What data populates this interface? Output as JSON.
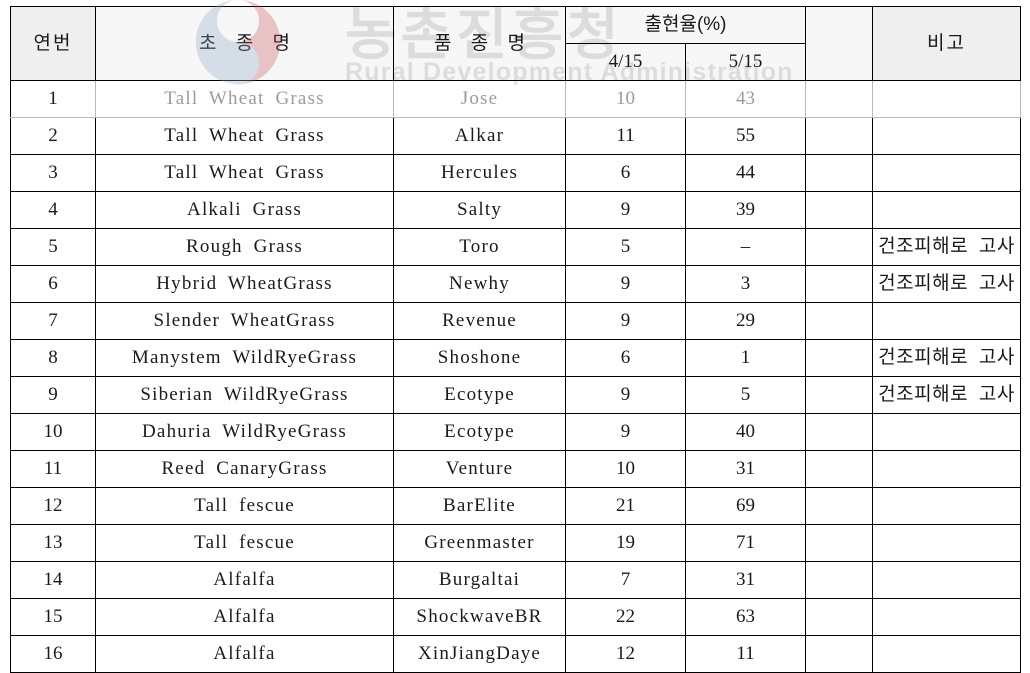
{
  "watermark": {
    "hangul": "농촌진흥청",
    "roman": "Rural Development Administration",
    "emblem": "taeguk-emblem",
    "colors": {
      "red": "#c94b55",
      "blue": "#5b7fa6"
    }
  },
  "table": {
    "headers": {
      "no": "연번",
      "species": "초 종 명",
      "variety": "품 종 명",
      "emergence_group": "출현율(%)",
      "date1": "4/15",
      "date2": "5/15",
      "spacer": "",
      "remark": "비고"
    },
    "rows": [
      {
        "no": "1",
        "species": "Tall Wheat Grass",
        "variety": "Jose",
        "d1": "10",
        "d2": "43",
        "remark": ""
      },
      {
        "no": "2",
        "species": "Tall Wheat Grass",
        "variety": "Alkar",
        "d1": "11",
        "d2": "55",
        "remark": ""
      },
      {
        "no": "3",
        "species": "Tall Wheat Grass",
        "variety": "Hercules",
        "d1": "6",
        "d2": "44",
        "remark": ""
      },
      {
        "no": "4",
        "species": "Alkali Grass",
        "variety": "Salty",
        "d1": "9",
        "d2": "39",
        "remark": ""
      },
      {
        "no": "5",
        "species": "Rough Grass",
        "variety": "Toro",
        "d1": "5",
        "d2": "–",
        "remark": "건조피해로 고사"
      },
      {
        "no": "6",
        "species": "Hybrid WheatGrass",
        "variety": "Newhy",
        "d1": "9",
        "d2": "3",
        "remark": "건조피해로 고사"
      },
      {
        "no": "7",
        "species": "Slender WheatGrass",
        "variety": "Revenue",
        "d1": "9",
        "d2": "29",
        "remark": ""
      },
      {
        "no": "8",
        "species": "Manystem WildRyeGrass",
        "variety": "Shoshone",
        "d1": "6",
        "d2": "1",
        "remark": "건조피해로 고사"
      },
      {
        "no": "9",
        "species": "Siberian WildRyeGrass",
        "variety": "Ecotype",
        "d1": "9",
        "d2": "5",
        "remark": "건조피해로 고사"
      },
      {
        "no": "10",
        "species": "Dahuria WildRyeGrass",
        "variety": "Ecotype",
        "d1": "9",
        "d2": "40",
        "remark": ""
      },
      {
        "no": "11",
        "species": "Reed CanaryGrass",
        "variety": "Venture",
        "d1": "10",
        "d2": "31",
        "remark": ""
      },
      {
        "no": "12",
        "species": "Tall fescue",
        "variety": "BarElite",
        "d1": "21",
        "d2": "69",
        "remark": ""
      },
      {
        "no": "13",
        "species": "Tall fescue",
        "variety": "Greenmaster",
        "d1": "19",
        "d2": "71",
        "remark": ""
      },
      {
        "no": "14",
        "species": "Alfalfa",
        "variety": "Burgaltai",
        "d1": "7",
        "d2": "31",
        "remark": ""
      },
      {
        "no": "15",
        "species": "Alfalfa",
        "variety": "ShockwaveBR",
        "d1": "22",
        "d2": "63",
        "remark": ""
      },
      {
        "no": "16",
        "species": "Alfalfa",
        "variety": "XinJiangDaye",
        "d1": "12",
        "d2": "11",
        "remark": ""
      }
    ]
  }
}
